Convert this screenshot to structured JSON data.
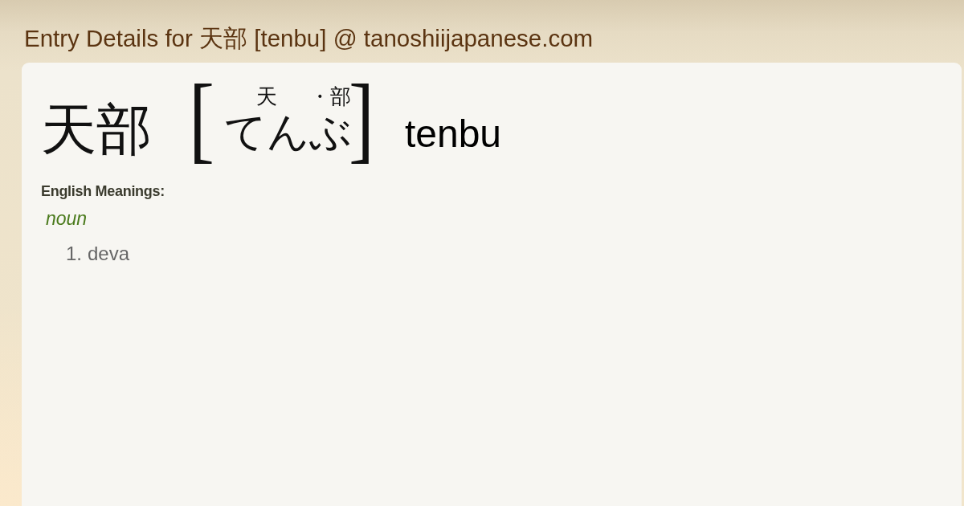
{
  "page_title": "Entry Details for 天部 [tenbu] @ tanoshiijapanese.com",
  "entry": {
    "kanji": "天部",
    "open_bracket": "[",
    "close_bracket": "]",
    "ruby": [
      {
        "furigana": "天",
        "kana": "てん"
      },
      {
        "furigana": "・部",
        "kana": "ぶ"
      }
    ],
    "romaji": "tenbu"
  },
  "meanings": {
    "heading": "English Meanings:",
    "part_of_speech": "noun",
    "items": [
      {
        "number": "1.",
        "text": "deva"
      }
    ]
  }
}
